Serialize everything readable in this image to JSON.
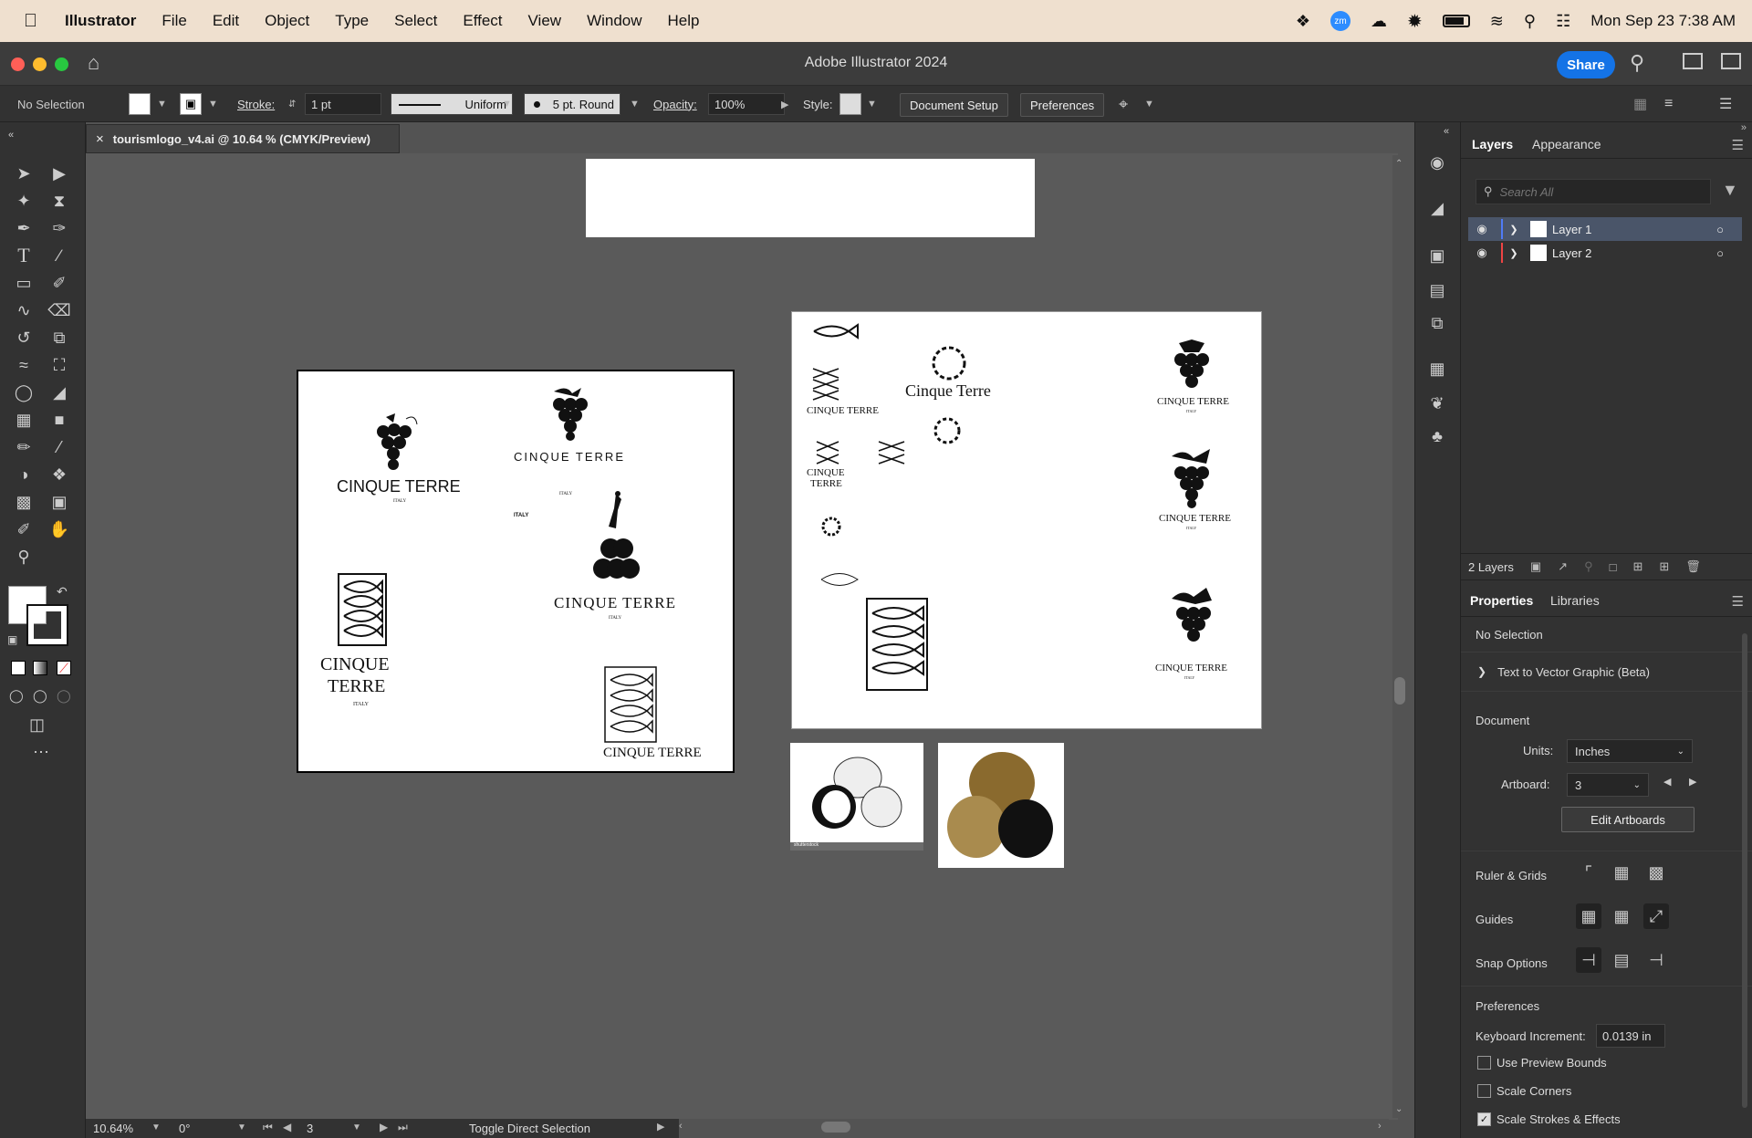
{
  "menubar": {
    "app_name": "Illustrator",
    "items": [
      "File",
      "Edit",
      "Object",
      "Type",
      "Select",
      "Effect",
      "View",
      "Window",
      "Help"
    ],
    "clock": "Mon Sep 23  7:38 AM",
    "zoom_badge": "zm"
  },
  "window": {
    "title": "Adobe Illustrator 2024",
    "share_label": "Share"
  },
  "controlbar": {
    "selection": "No Selection",
    "stroke_label": "Stroke:",
    "stroke_value": "1 pt",
    "profile_label": "Uniform",
    "brush_label": "5 pt. Round",
    "opacity_label": "Opacity:",
    "opacity_value": "100%",
    "style_label": "Style:",
    "document_setup": "Document Setup",
    "preferences": "Preferences"
  },
  "document": {
    "tab_title": "tourismlogo_v4.ai @ 10.64 % (CMYK/Preview)",
    "close_glyph": "×"
  },
  "artwork": {
    "cinque_terre": "CINQUE TERRE",
    "cinque_terre_title": "Cinque Terre",
    "cinque_terre_mixed": "CINQUE TERRE",
    "cinque": "CINQUE",
    "terre": "TERRE",
    "italy": "ITALY",
    "barrel_caption": "shutterstock"
  },
  "statusbar": {
    "zoom": "10.64%",
    "rotation": "0°",
    "artboard_num": "3",
    "toggle_label": "Toggle Direct Selection"
  },
  "layers_panel": {
    "tab_layers": "Layers",
    "tab_appearance": "Appearance",
    "search_placeholder": "Search All",
    "layers": [
      {
        "name": "Layer 1",
        "color": "#4f7bf6"
      },
      {
        "name": "Layer 2",
        "color": "#ee4444"
      }
    ],
    "count": "2 Layers"
  },
  "properties_panel": {
    "tab_properties": "Properties",
    "tab_libraries": "Libraries",
    "selection": "No Selection",
    "text_to_vector": "Text to Vector Graphic (Beta)",
    "document_label": "Document",
    "units_label": "Units:",
    "units_value": "Inches",
    "artboard_label": "Artboard:",
    "artboard_value": "3",
    "edit_artboards": "Edit Artboards",
    "ruler_grids": "Ruler & Grids",
    "guides": "Guides",
    "snap_options": "Snap Options",
    "preferences_label": "Preferences",
    "keyboard_increment_label": "Keyboard Increment:",
    "keyboard_increment_value": "0.0139 in",
    "use_preview_bounds": "Use Preview Bounds",
    "scale_corners": "Scale Corners",
    "scale_strokes": "Scale Strokes & Effects",
    "scale_strokes_checked": true
  },
  "colors": {
    "accent": "#1473e6",
    "panel_bg": "#323232",
    "canvas_bg": "#5a5a5a"
  }
}
